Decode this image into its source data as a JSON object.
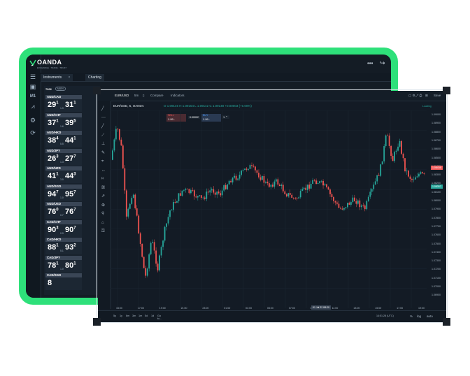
{
  "app": {
    "brand": "OANDA",
    "tagline": "EXCHANGE · TRADE · TRUST"
  },
  "topbar": {
    "more": "•••",
    "logout": "↪"
  },
  "tabs": {
    "instruments": "Instruments",
    "charting": "Charting",
    "close": "×",
    "close2": "×",
    "filter": "7002",
    "filter2": "MAIN"
  },
  "sidebar_icons": [
    "list-icon",
    "chart-icon",
    "mt-icon",
    "trend-icon",
    "gear-icon",
    "refresh-icon"
  ],
  "sidebar_labels": [
    "☰",
    "▣",
    "M1",
    "⩘",
    "⚙",
    "⟳"
  ],
  "instruments": [
    {
      "pair": "AUD/CAD",
      "sell": "29",
      "sell_sup": "1",
      "buy": "31",
      "buy_sup": "1",
      "spread": "1.9"
    },
    {
      "pair": "AUD/CHF",
      "sell": "37",
      "sell_sup": "1",
      "buy": "39",
      "buy_sup": "5",
      "spread": "1.6"
    },
    {
      "pair": "AUD/HKD",
      "sell": "38",
      "sell_sup": "4",
      "buy": "44",
      "buy_sup": "1",
      "spread": "5.5"
    },
    {
      "pair": "AUD/JPY",
      "sell": "26",
      "sell_sup": "3",
      "buy": "27",
      "buy_sup": "7",
      "spread": "1.3"
    },
    {
      "pair": "AUD/NZD",
      "sell": "41",
      "sell_sup": "1",
      "buy": "44",
      "buy_sup": "3",
      "spread": "3.0"
    },
    {
      "pair": "AUD/SGD",
      "sell": "94",
      "sell_sup": "7",
      "buy": "95",
      "buy_sup": "7",
      "spread": "1.0"
    },
    {
      "pair": "AUD/USD",
      "sell": "76",
      "sell_sup": "0",
      "buy": "76",
      "buy_sup": "7",
      "spread": "0.7"
    },
    {
      "pair": "CAD/CHF",
      "sell": "90",
      "sell_sup": "3",
      "buy": "90",
      "buy_sup": "7",
      "spread": "0.9"
    },
    {
      "pair": "CAD/HKD",
      "sell": "88",
      "sell_sup": "1",
      "buy": "93",
      "buy_sup": "2",
      "spread": "5.1"
    },
    {
      "pair": "CAD/JPY",
      "sell": "78",
      "sell_sup": "1",
      "buy": "80",
      "buy_sup": "1",
      "spread": "1.0"
    },
    {
      "pair": "CAD/SGD",
      "sell": "8",
      "sell_sup": "",
      "buy": "",
      "buy_sup": "",
      "spread": ""
    }
  ],
  "chart": {
    "symbol": "EUR/USD",
    "timeframe": "5m",
    "compare": "Compare",
    "indicators": "Indicators",
    "legend": "EUR/USD, 5, OANDA",
    "ohlc": "O 1.09145  H 1.09154  L 1.09142  C 1.09148  +0.00003 (+0.00%)",
    "sell_label": "SELL",
    "sell_price": "1.09..",
    "spread": "0.00002",
    "buy_label": "BUY",
    "buy_price": "1.09..",
    "save": "Save",
    "status": "Loading",
    "x_ticks": [
      "15:00",
      "17:00",
      "19:00",
      "21:00",
      "23:00",
      "01:00",
      "03:00",
      "05:00",
      "07:00",
      "09:00",
      "11:00",
      "13:00",
      "15:00",
      "17:00",
      "19:00"
    ],
    "x_cursor": "01 Jul 22  08:20",
    "time_ranges": [
      "5y",
      "1y",
      "6m",
      "3m",
      "1m",
      "5d",
      "1d",
      "Go to..."
    ],
    "bottom_right": [
      "14:51:28 (UTC)",
      "%",
      "log",
      "auto"
    ],
    "y_ticks": [
      "1.09000",
      "1.08900",
      "1.08800",
      "1.08700",
      "1.08600",
      "1.08500",
      "1.08400",
      "1.08300",
      "1.08200",
      "1.08100",
      "1.08000",
      "1.07900",
      "1.07800",
      "1.07700",
      "1.07600",
      "1.07500",
      "1.07400",
      "1.07300",
      "1.07200",
      "1.07100",
      "1.07000",
      "1.06900"
    ],
    "price_tag_1": "1.08436",
    "price_tag_2": "1.08357"
  }
}
